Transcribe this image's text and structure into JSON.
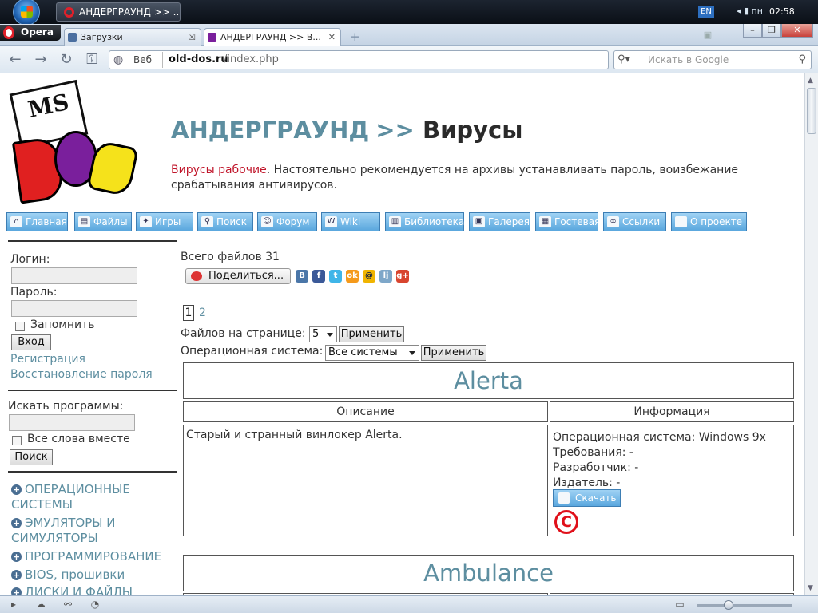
{
  "taskbar": {
    "task_label": "АНДЕРГРАУНД >> ...",
    "lang": "EN",
    "tray_text": "пн",
    "clock": "02:58"
  },
  "browser": {
    "menu_label": "Opera",
    "tabs": [
      {
        "label": "Загрузки",
        "active": false
      },
      {
        "label": "АНДЕРГРАУНД >> В...",
        "active": true
      }
    ],
    "address": {
      "mode_label": "Веб",
      "host": "old-dos.ru",
      "path": "/index.php"
    },
    "search_placeholder": "Искать в Google"
  },
  "page": {
    "title_part1": "АНДЕРГРАУНД",
    "title_sep": ">>",
    "title_part2": "Вирусы",
    "intro_highlight": "Вирусы рабочие",
    "intro_text": ". Настоятельно рекомендуется на архивы устанавливать пароль, воизбежание срабатывания антивирусов.",
    "menu": [
      {
        "label": "Главная",
        "icon": "home-icon"
      },
      {
        "label": "Файлы",
        "icon": "files-icon"
      },
      {
        "label": "Игры",
        "icon": "games-icon"
      },
      {
        "label": "Поиск",
        "icon": "search-icon"
      },
      {
        "label": "Форум",
        "icon": "forum-icon"
      },
      {
        "label": "Wiki",
        "icon": "wiki-icon"
      },
      {
        "label": "Библиотека",
        "icon": "library-icon"
      },
      {
        "label": "Галерея",
        "icon": "gallery-icon"
      },
      {
        "label": "Гостевая",
        "icon": "guestbook-icon"
      },
      {
        "label": "Ссылки",
        "icon": "links-icon"
      },
      {
        "label": "О проекте",
        "icon": "info-icon"
      }
    ],
    "sidebar": {
      "login_label": "Логин:",
      "password_label": "Пароль:",
      "remember_label": "Запомнить",
      "login_button": "Вход",
      "register_link": "Регистрация",
      "restore_link": "Восстановление пароля",
      "search_label": "Искать программы:",
      "all_words_label": "Все слова вместе",
      "search_button": "Поиск",
      "categories": [
        "ОПЕРАЦИОННЫЕ СИСТЕМЫ",
        "ЭМУЛЯТОРЫ И СИМУЛЯТОРЫ",
        "ПРОГРАММИРОВАНИЕ",
        "BIOS, прошивки",
        "ДИСКИ И ФАЙЛЫ"
      ]
    },
    "content": {
      "total_files": "Всего файлов 31",
      "share_label": "Поделиться...",
      "social": [
        "В",
        "f",
        "t",
        "ok",
        "@",
        "lj",
        "g+"
      ],
      "pages": [
        "1",
        "2"
      ],
      "per_page_label": "Файлов на странице:",
      "per_page_value": "5",
      "apply_label": "Применить",
      "os_label": "Операционная система:",
      "os_value": "Все системы",
      "programs": [
        {
          "name": "Alerta",
          "col_desc": "Описание",
          "col_info": "Информация",
          "description": "Старый и странный винлокер Alerta.",
          "info_os": "Операционная система: Windows 9x",
          "info_req": "Требования: -",
          "info_dev": "Разработчик: -",
          "info_pub": "Издатель: -",
          "download_label": "Скачать",
          "copyright_symbol": "C"
        },
        {
          "name": "Ambulance"
        }
      ]
    }
  },
  "colors": {
    "link": "#5d8ea0",
    "accent_red": "#c0152a",
    "button_blue": "#5aa7de"
  }
}
